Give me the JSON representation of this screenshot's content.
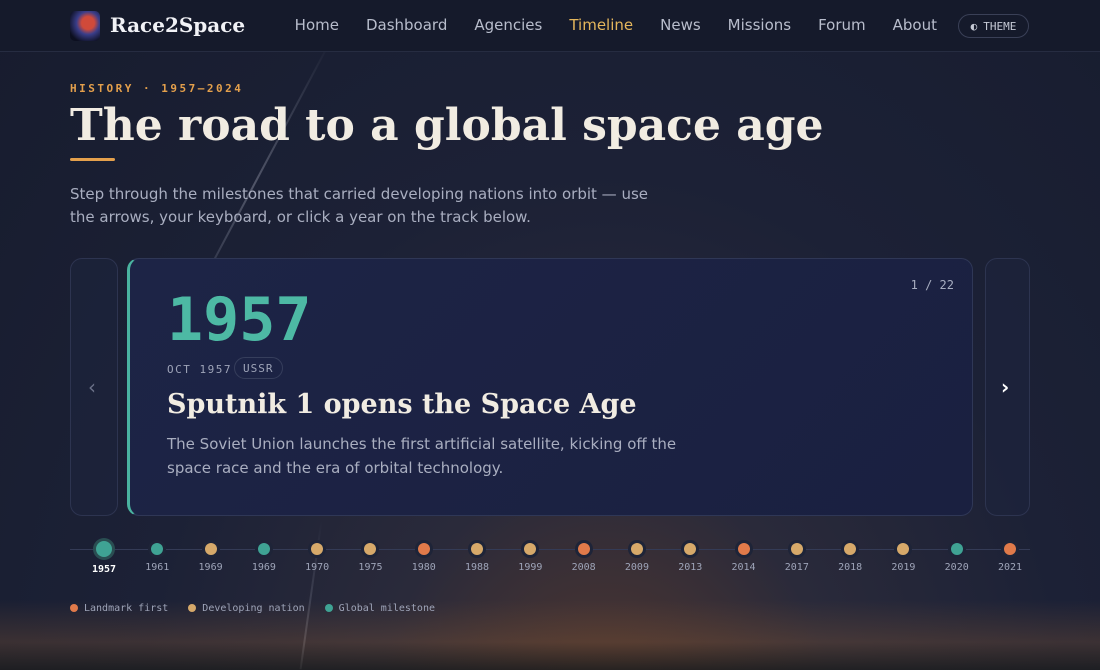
{
  "brand": {
    "name": "Race2Space",
    "logo_icon": "rocket-logo-icon"
  },
  "nav": {
    "items": [
      "Home",
      "Dashboard",
      "Agencies",
      "Timeline",
      "News",
      "Missions",
      "Forum",
      "About"
    ],
    "active": "Timeline",
    "theme_label": "THEME",
    "theme_icon": "◐"
  },
  "hero": {
    "eyebrow": "HISTORY · 1957–2024",
    "title": "The road to a global space age",
    "lead": "Step through the milestones that carried developing nations into orbit — use the arrows, your keyboard, or click a year on the track below."
  },
  "card": {
    "counter": "1 / 22",
    "year": "1957",
    "date": "OCT 1957",
    "tag": "USSR",
    "title": "Sputnik 1 opens the Space Age",
    "description": "The Soviet Union launches the first artificial satellite, kicking off the space race and the era of orbital technology."
  },
  "controls": {
    "prev": "‹",
    "next": "›"
  },
  "colors": {
    "landmark": "#e07a4a",
    "developing": "#d6a96a",
    "global": "#3fa394",
    "accent": "#e4b65c",
    "year": "#4db9a4"
  },
  "timeline": [
    {
      "year": "1957",
      "type": "global"
    },
    {
      "year": "1961",
      "type": "global"
    },
    {
      "year": "1969",
      "type": "developing"
    },
    {
      "year": "1969",
      "type": "global"
    },
    {
      "year": "1970",
      "type": "developing"
    },
    {
      "year": "1975",
      "type": "developing"
    },
    {
      "year": "1980",
      "type": "landmark"
    },
    {
      "year": "1988",
      "type": "developing"
    },
    {
      "year": "1999",
      "type": "developing"
    },
    {
      "year": "2008",
      "type": "landmark"
    },
    {
      "year": "2009",
      "type": "developing"
    },
    {
      "year": "2013",
      "type": "developing"
    },
    {
      "year": "2014",
      "type": "landmark"
    },
    {
      "year": "2017",
      "type": "developing"
    },
    {
      "year": "2018",
      "type": "developing"
    },
    {
      "year": "2019",
      "type": "developing"
    },
    {
      "year": "2020",
      "type": "global"
    },
    {
      "year": "2021",
      "type": "landmark"
    }
  ],
  "timeline_active": 0,
  "legend": [
    {
      "label": "Landmark first",
      "type": "landmark"
    },
    {
      "label": "Developing nation",
      "type": "developing"
    },
    {
      "label": "Global milestone",
      "type": "global"
    }
  ]
}
